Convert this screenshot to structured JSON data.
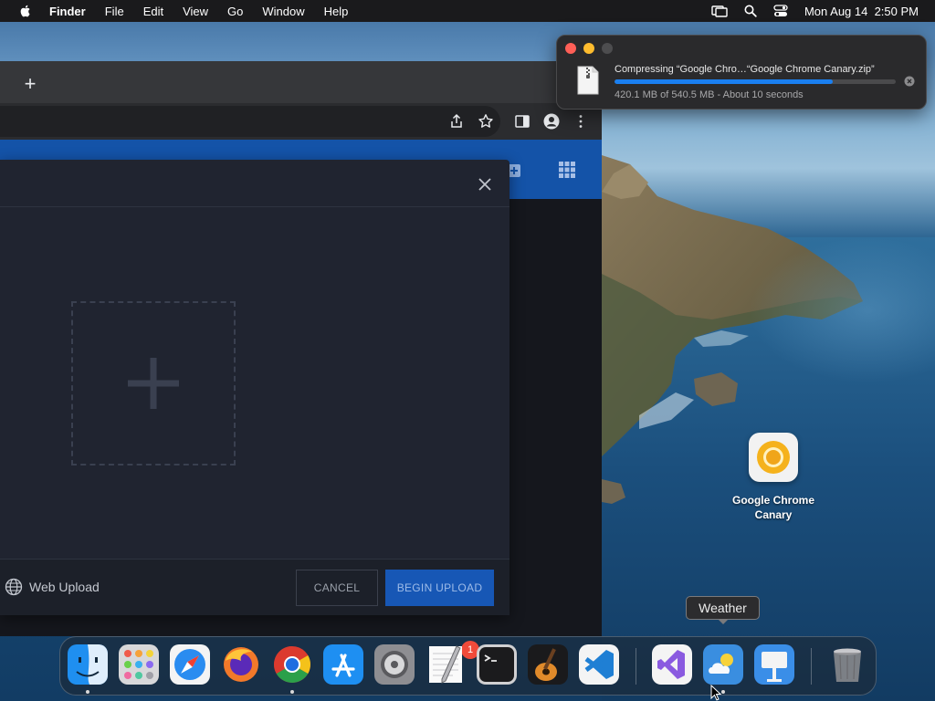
{
  "menubar": {
    "apple_icon": "apple-icon",
    "items": [
      {
        "label": "Finder",
        "bold": true
      },
      {
        "label": "File"
      },
      {
        "label": "Edit"
      },
      {
        "label": "View"
      },
      {
        "label": "Go"
      },
      {
        "label": "Window"
      },
      {
        "label": "Help"
      }
    ],
    "status_icons": [
      "screen-mirroring-icon",
      "spotlight-search-icon",
      "control-center-icon"
    ],
    "clock": "Mon Aug 14  2:50 PM"
  },
  "browser": {
    "new_tab_label": "+",
    "toolbar_icons": [
      "share-icon",
      "bookmark-star-icon",
      "side-panel-icon",
      "profile-icon",
      "menu-kebab-icon"
    ],
    "header_icons": [
      "add-icon",
      "apps-grid-icon"
    ],
    "upload_dialog": {
      "close_icon": "close-icon",
      "dropzone_icon": "plus-icon",
      "web_upload_label": "Web Upload",
      "cancel_label": "CANCEL",
      "begin_upload_label": "BEGIN UPLOAD"
    }
  },
  "notification": {
    "title": "Compressing “Google Chro…“Google Chrome Canary.zip”",
    "progress": 0.777,
    "detail": "420.1 MB of 540.5 MB - About 10 seconds",
    "colors": {
      "progress": "#1a7ff0"
    }
  },
  "desktop": {
    "items": [
      {
        "label_line1": "Google Chrome",
        "label_line2": "Canary",
        "icon": "chrome-canary-icon"
      }
    ]
  },
  "dock": {
    "tooltip": "Weather",
    "apps": [
      {
        "name": "Finder",
        "icon": "finder-icon",
        "running": true
      },
      {
        "name": "Launchpad",
        "icon": "launchpad-icon"
      },
      {
        "name": "Safari",
        "icon": "safari-icon"
      },
      {
        "name": "Firefox",
        "icon": "firefox-icon"
      },
      {
        "name": "Google Chrome",
        "icon": "chrome-icon",
        "running": true
      },
      {
        "name": "App Store",
        "icon": "app-store-icon"
      },
      {
        "name": "System Settings",
        "icon": "system-settings-icon",
        "badge": "1"
      },
      {
        "name": "TextEdit",
        "icon": "textedit-icon"
      },
      {
        "name": "Terminal",
        "icon": "terminal-icon"
      },
      {
        "name": "GarageBand",
        "icon": "garageband-icon"
      },
      {
        "name": "Visual Studio Code",
        "icon": "vscode-icon"
      },
      {
        "name": "Visual Studio",
        "icon": "visual-studio-icon"
      },
      {
        "name": "Weather",
        "icon": "weather-icon",
        "running": true
      },
      {
        "name": "Keynote",
        "icon": "keynote-icon"
      },
      {
        "name": "Trash",
        "icon": "trash-icon"
      }
    ]
  }
}
